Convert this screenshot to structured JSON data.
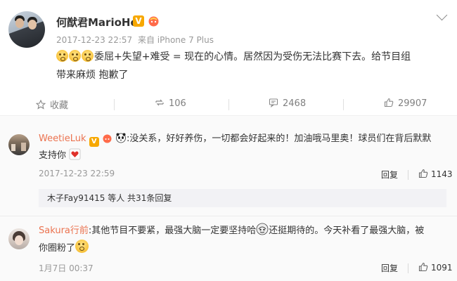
{
  "post": {
    "username": "何猷君MarioHo",
    "verified_badge": "V",
    "timestamp": "2017-12-23 22:57",
    "source": "来自 iPhone 7 Plus",
    "emojis": [
      "shocked-face-emoji",
      "shocked-face-emoji",
      "shocked-face-emoji"
    ],
    "text_line1": "委屈+失望+难受 = 现在的心情。居然因为受伤无法比赛下去。给节目组",
    "text_line2": "带来麻烦 抱歉了"
  },
  "actions": {
    "favorite_label": "收藏",
    "repost_count": "106",
    "comment_count": "2468",
    "like_count": "29907"
  },
  "comments": [
    {
      "name": "WeetieLuk",
      "badge": "V",
      "text_line1": ":没关系，好好养伤，一切都会好起来的！加油哦马里奥！球员们在背后默默",
      "text_line2": "支持你",
      "time": "2017-12-23 22:59",
      "reply_label": "回复",
      "likes": "1143",
      "subreply_text": "木子Fay91415 等人 共31条回复"
    },
    {
      "name": "Sakura行前",
      "text_line1a": ":其他节目不要紧，最强大脑一定要坚持哈",
      "text_line1b": "还挺期待的。今天补看了最强大脑，被",
      "text_line2": "你圈粉了",
      "time": "1月7日 00:37",
      "reply_label": "回复",
      "likes": "1091"
    }
  ],
  "colors": {
    "link": "#eb7350",
    "meta": "#999999",
    "badge": "#f7a800"
  }
}
